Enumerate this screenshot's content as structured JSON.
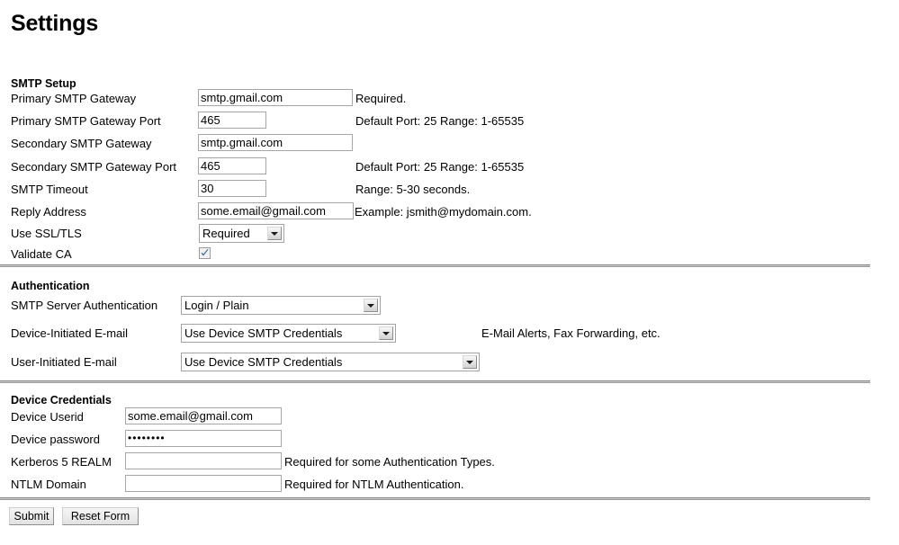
{
  "page": {
    "title": "Settings"
  },
  "sections": {
    "smtp": {
      "heading": "SMTP Setup",
      "rows": [
        {
          "label": "Primary SMTP Gateway",
          "value": "smtp.gmail.com",
          "hint": "Required."
        },
        {
          "label": "Primary SMTP Gateway Port",
          "value": "465",
          "hint": "Default Port: 25 Range: 1-65535"
        },
        {
          "label": "Secondary SMTP Gateway",
          "value": "smtp.gmail.com",
          "hint": ""
        },
        {
          "label": "Secondary SMTP Gateway Port",
          "value": "465",
          "hint": "Default Port: 25 Range: 1-65535"
        },
        {
          "label": "SMTP Timeout",
          "value": "30",
          "hint": "Range: 5-30 seconds."
        },
        {
          "label": "Reply Address",
          "value": "some.email@gmail.com",
          "hint": "Example: jsmith@mydomain.com."
        },
        {
          "label": "Use SSL/TLS",
          "value": "Required",
          "hint": ""
        },
        {
          "label": "Validate CA",
          "value": "checked",
          "hint": ""
        }
      ]
    },
    "authentication": {
      "heading": "Authentication",
      "rows": [
        {
          "label": "SMTP Server Authentication",
          "value": "Login / Plain",
          "hint": ""
        },
        {
          "label": "Device-Initiated E-mail",
          "value": "Use Device SMTP Credentials",
          "hint": "E-Mail Alerts, Fax Forwarding, etc."
        },
        {
          "label": "User-Initiated E-mail",
          "value": "Use Device SMTP Credentials",
          "hint": ""
        }
      ]
    },
    "device_credentials": {
      "heading": "Device Credentials",
      "rows": [
        {
          "label": "Device Userid",
          "value": "some.email@gmail.com",
          "hint": ""
        },
        {
          "label": "Device password",
          "value": "••••••••",
          "hint": ""
        },
        {
          "label": "Kerberos 5 REALM",
          "value": "",
          "hint": "Required for some Authentication Types."
        },
        {
          "label": "NTLM Domain",
          "value": "",
          "hint": "Required for NTLM Authentication."
        }
      ]
    }
  },
  "actions": {
    "submit_label": "Submit",
    "reset_label": "Reset Form"
  },
  "colors": {
    "background": "#ffffff",
    "text": "#000000",
    "border": "#a6a6a6",
    "divider": "#8a8a8a",
    "checkmark": "#2b5797"
  }
}
